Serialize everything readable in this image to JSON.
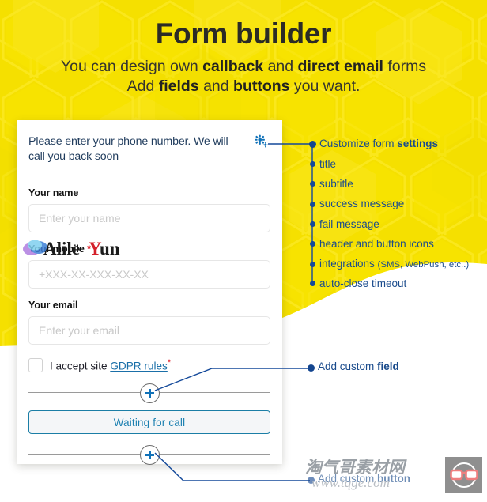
{
  "hero": {
    "title": "Form builder",
    "subtitle_line1_a": "You can design own ",
    "subtitle_line1_b": "callback",
    "subtitle_line1_c": " and ",
    "subtitle_line1_d": "direct email",
    "subtitle_line1_e": " forms",
    "subtitle_line2_a": "Add ",
    "subtitle_line2_b": "fields",
    "subtitle_line2_c": " and ",
    "subtitle_line2_d": "buttons",
    "subtitle_line2_e": " you want.",
    "bg_color": "#f5e000",
    "title_color": "#2b2b26"
  },
  "form": {
    "header_text": "Please enter your phone number. We will call you back soon",
    "gear_icon": "gear-icon",
    "fields": [
      {
        "label": "Your name",
        "required": false,
        "placeholder": "Enter your name",
        "value": ""
      },
      {
        "label": "Your mobile",
        "required": true,
        "placeholder": "+XXX-XX-XXX-XX-XX",
        "value": ""
      },
      {
        "label": "Your email",
        "required": false,
        "placeholder": "Enter your email",
        "value": ""
      }
    ],
    "gdpr": {
      "checked": false,
      "text_before": "I accept site ",
      "link_text": "GDPR rules",
      "required_mark": "*"
    },
    "add_field_icon": "plus-icon",
    "submit_button": {
      "label": "Waiting for call",
      "border_color": "#1b7ea6",
      "text_color": "#1a7fb0",
      "bg_color": "#f4f6f8"
    },
    "add_button_icon": "plus-icon"
  },
  "annotations": {
    "settings_list": [
      {
        "text_plain": "Customize form ",
        "text_bold": "settings",
        "bold_last": true
      },
      {
        "text_plain": "title",
        "text_bold": "",
        "bold_last": false
      },
      {
        "text_plain": "subtitle",
        "text_bold": "",
        "bold_last": false
      },
      {
        "text_plain": "success message",
        "text_bold": "",
        "bold_last": false
      },
      {
        "text_plain": "fail message",
        "text_bold": "",
        "bold_last": false
      },
      {
        "text_plain": "header and button icons",
        "text_bold": "",
        "bold_last": false
      },
      {
        "text_plain": "integrations ",
        "text_bold": "(SMS, WebPush, etc..)",
        "bold_last": false
      }
    ],
    "auto_close": "auto-close timeout",
    "add_custom_field_a": "Add custom ",
    "add_custom_field_b": "field",
    "add_custom_button_a": "Add custom ",
    "add_custom_button_b": "button",
    "line_color": "#14499a",
    "text_color": "#1a4b8c"
  },
  "watermarks": {
    "alicloud_text": "AlileYun",
    "site_text_cn": "淘气哥素材网",
    "site_text_url": "www.tqge.com",
    "logo_icon": "glasses-icon"
  }
}
